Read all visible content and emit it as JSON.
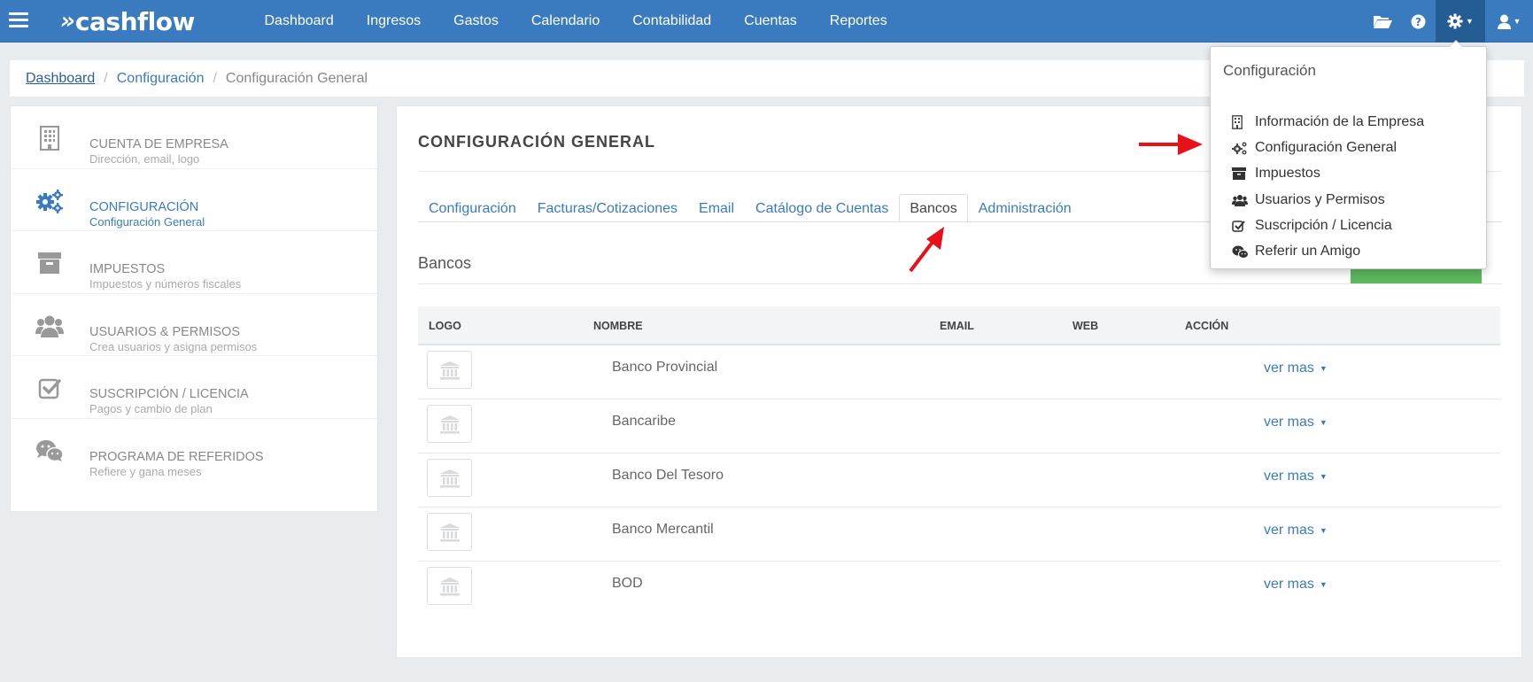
{
  "app": {
    "brand": "cashflow",
    "nav": [
      "Dashboard",
      "Ingresos",
      "Gastos",
      "Calendario",
      "Contabilidad",
      "Cuentas",
      "Reportes"
    ],
    "icons": [
      "menu-icon",
      "folder-open-icon",
      "help-icon",
      "gear-icon",
      "user-icon"
    ]
  },
  "breadcrumb": {
    "home": "Dashboard",
    "parent": "Configuración",
    "current": "Configuración General",
    "separator": "/"
  },
  "sidebar": {
    "items": [
      {
        "title": "CUENTA DE EMPRESA",
        "subtitle": "Dirección, email, logo",
        "icon": "building-icon",
        "active": false
      },
      {
        "title": "CONFIGURACIÓN",
        "subtitle": "Configuración General",
        "icon": "gears-icon",
        "active": true
      },
      {
        "title": "IMPUESTOS",
        "subtitle": "Impuestos y números fiscales",
        "icon": "archive-icon",
        "active": false
      },
      {
        "title": "USUARIOS & PERMISOS",
        "subtitle": "Crea usuarios y asigna permisos",
        "icon": "users-icon",
        "active": false
      },
      {
        "title": "SUSCRIPCIÓN / LICENCIA",
        "subtitle": "Pagos y cambio de plan",
        "icon": "check-square-icon",
        "active": false
      },
      {
        "title": "PROGRAMA DE REFERIDOS",
        "subtitle": "Refiere y gana meses",
        "icon": "wechat-icon",
        "active": false
      }
    ]
  },
  "main": {
    "title": "CONFIGURACIÓN GENERAL",
    "tabs": [
      "Configuración",
      "Facturas/Cotizaciones",
      "Email",
      "Catálogo de Cuentas",
      "Bancos",
      "Administración"
    ],
    "active_tab": "Bancos",
    "section_title": "Bancos",
    "table": {
      "columns": [
        "LOGO",
        "NOMBRE",
        "EMAIL",
        "WEB",
        "ACCIÓN"
      ],
      "rows": [
        {
          "name": "Banco Provincial",
          "email": "",
          "web": "",
          "action": "ver mas"
        },
        {
          "name": "Bancaribe",
          "email": "",
          "web": "",
          "action": "ver mas"
        },
        {
          "name": "Banco Del Tesoro",
          "email": "",
          "web": "",
          "action": "ver mas"
        },
        {
          "name": "Banco Mercantil",
          "email": "",
          "web": "",
          "action": "ver mas"
        },
        {
          "name": "BOD",
          "email": "",
          "web": "",
          "action": "ver mas"
        }
      ]
    }
  },
  "dropdown": {
    "header": "Configuración",
    "items": [
      {
        "label": "Información de la Empresa",
        "icon": "building-icon"
      },
      {
        "label": "Configuración General",
        "icon": "gears-icon"
      },
      {
        "label": "Impuestos",
        "icon": "archive-icon"
      },
      {
        "label": "Usuarios y Permisos",
        "icon": "users-icon"
      },
      {
        "label": "Suscripción / Licencia",
        "icon": "check-square-icon"
      },
      {
        "label": "Referir un Amigo",
        "icon": "wechat-icon"
      }
    ]
  },
  "colors": {
    "topbar": "#3a7bbf",
    "link": "#3a7bbf",
    "annotation_arrow": "#e8111a",
    "button_green": "#5cb85c"
  }
}
